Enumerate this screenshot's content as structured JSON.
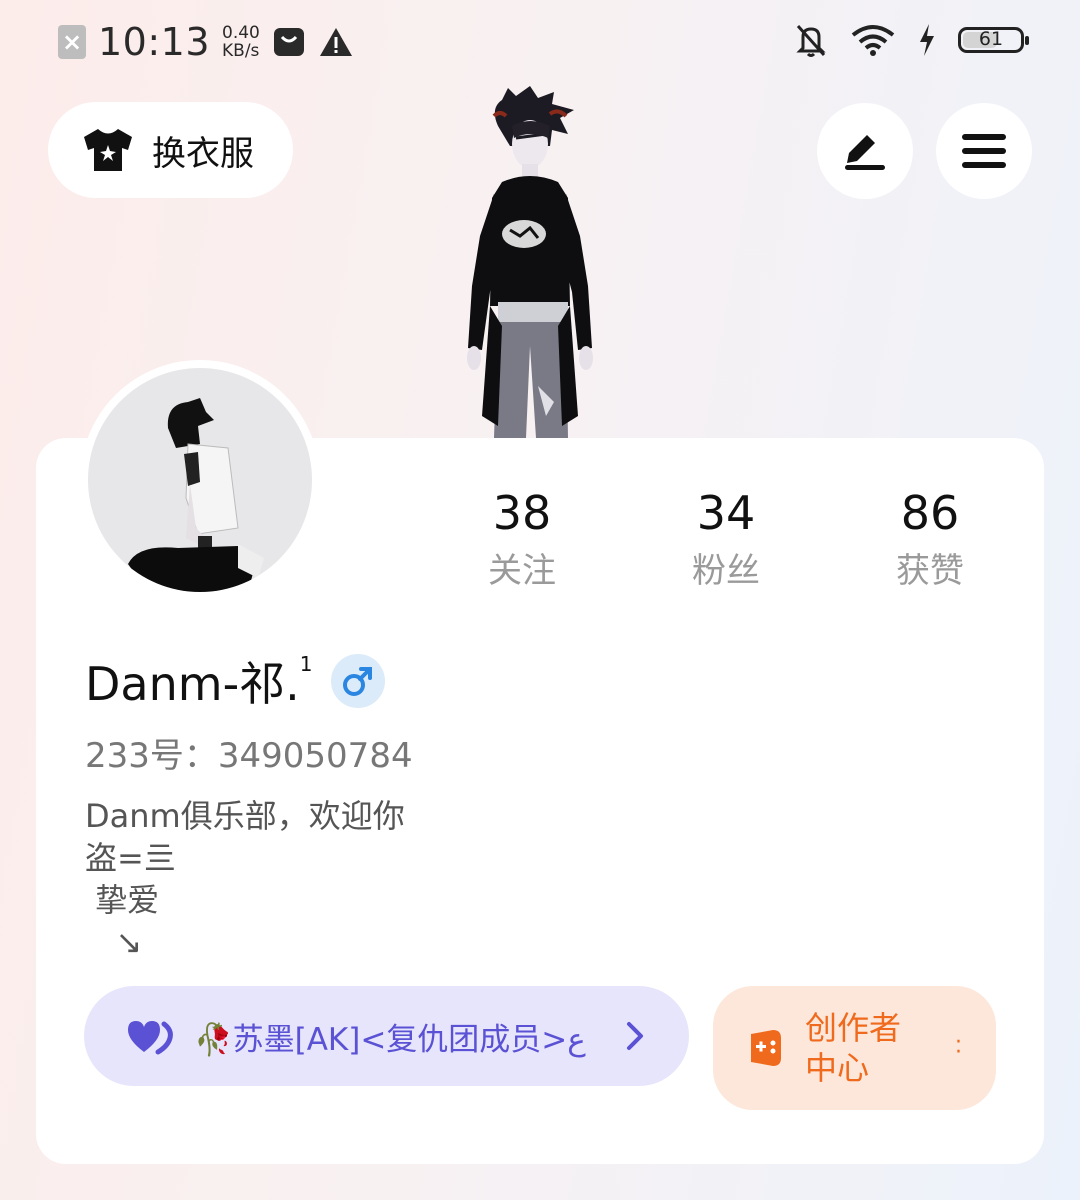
{
  "status_bar": {
    "time": "10:13",
    "net_speed_value": "0.40",
    "net_speed_unit": "KB/s",
    "battery": "61",
    "battery_level": 0.61
  },
  "header": {
    "outfit_label": "换衣服",
    "edit_icon": "pen-icon",
    "menu_icon": "hamburger-icon"
  },
  "profile": {
    "nickname": "Danm-祁.",
    "nickname_sup": "1",
    "gender_symbol": "♂",
    "uid": "233号：349050784",
    "bio_lines": [
      "Danm俱乐部，欢迎你",
      "盗=亖",
      " 挚爱",
      "   ↘"
    ]
  },
  "stats": [
    {
      "value": "38",
      "label": "关注"
    },
    {
      "value": "34",
      "label": "粉丝"
    },
    {
      "value": "86",
      "label": "获赞"
    }
  ],
  "relation": {
    "text": "🥀苏墨[AK]<复仇团成员>ع"
  },
  "creator": {
    "label": "创作者中心"
  },
  "colors": {
    "relation_bg": "#e6e5fb",
    "relation_fg": "#5a51d4",
    "creator_bg": "#fde7da",
    "creator_fg": "#f06a1d",
    "gender_fg": "#2a86e0"
  }
}
